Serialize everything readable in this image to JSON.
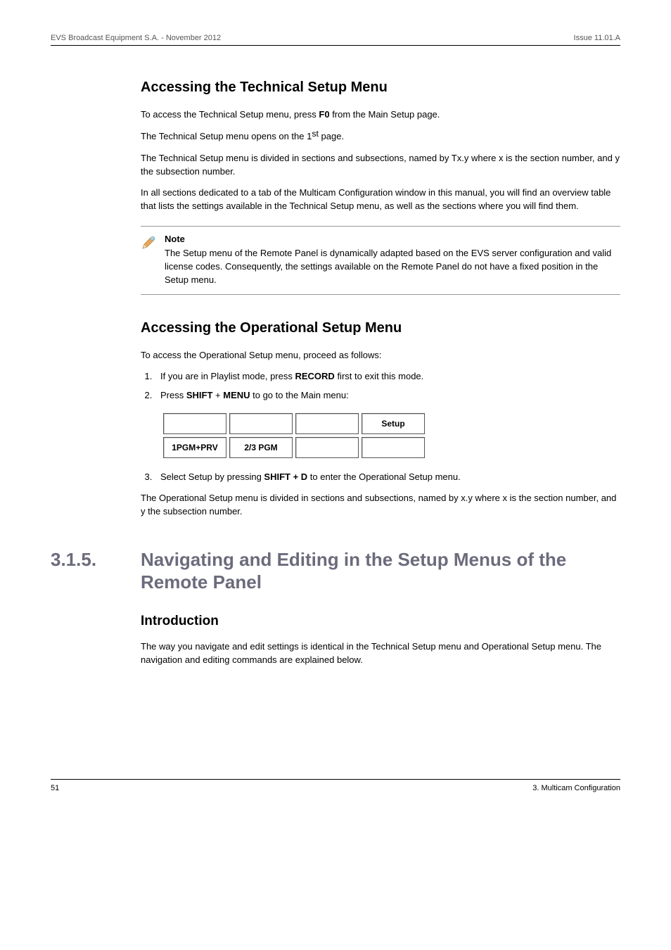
{
  "header": {
    "left": "EVS Broadcast Equipment S.A.  - November 2012",
    "right": "Issue 11.01.A"
  },
  "tech": {
    "heading": "Accessing the Technical Setup Menu",
    "p1_a": "To access the Technical Setup menu, press ",
    "p1_bold": "F0",
    "p1_b": " from the Main Setup page.",
    "p2_a": "The Technical Setup menu opens on the 1",
    "p2_st": "st",
    "p2_b": " page.",
    "p3": "The Technical Setup menu is divided in sections and subsections, named by Tx.y where x is the section number, and y the subsection number.",
    "p4": "In all sections dedicated to a tab of the Multicam Configuration window in this manual, you will find an overview table that lists the settings available in the Technical Setup menu, as well as the sections where you will find them."
  },
  "note": {
    "title": "Note",
    "body": "The Setup menu of the Remote Panel is dynamically adapted based on the EVS server configuration and valid license codes. Consequently, the settings available on the Remote Panel do not have a fixed position in the Setup menu."
  },
  "op": {
    "heading": "Accessing the Operational Setup Menu",
    "intro": "To access the Operational Setup menu, proceed as follows:",
    "step1_a": "If you are in Playlist mode, press ",
    "step1_bold": "RECORD",
    "step1_b": " first to exit this mode.",
    "step2_a": "Press ",
    "step2_b1": "SHIFT",
    "step2_plus": " + ",
    "step2_b2": "MENU",
    "step2_c": " to go to the Main menu:",
    "menu": {
      "r1c1": "",
      "r1c2": "",
      "r1c3": "",
      "r1c4": "Setup",
      "r2c1": "1PGM+PRV",
      "r2c2": "2/3 PGM",
      "r2c3": "",
      "r2c4": ""
    },
    "step3_a": "Select Setup by pressing ",
    "step3_bold": "SHIFT + D",
    "step3_b": " to enter the Operational Setup menu.",
    "closing": "The Operational Setup menu is divided in sections and subsections, named by x.y where x is the section number, and y the subsection number."
  },
  "section": {
    "num": "3.1.5.",
    "title": "Navigating and Editing in the Setup Menus of the Remote Panel"
  },
  "intro": {
    "heading": "Introduction",
    "body": "The way you navigate and edit settings is identical in the Technical Setup menu and Operational Setup menu. The navigation and editing commands are explained below."
  },
  "footer": {
    "left": "51",
    "right": "3. Multicam Configuration"
  }
}
